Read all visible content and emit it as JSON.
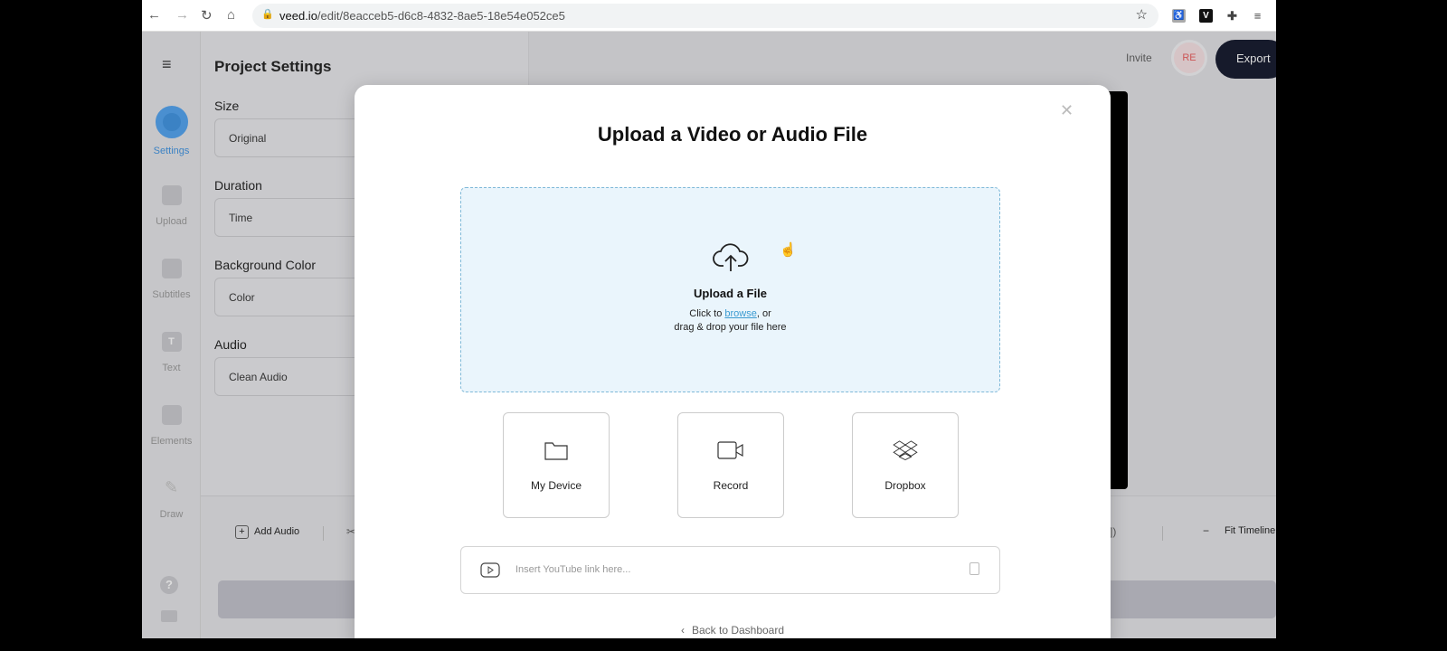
{
  "browser": {
    "url_domain": "veed.io",
    "url_path": "/edit/8eacceb5-d6c8-4832-8ae5-18e54e052ce5",
    "extensions": [
      "accessibility-icon",
      "veed-v-icon",
      "puzzle-icon",
      "media-icon"
    ],
    "ext_v": "V"
  },
  "rail": {
    "items": [
      {
        "label": "Settings",
        "active": true
      },
      {
        "label": "Upload"
      },
      {
        "label": "Subtitles"
      },
      {
        "label": "Text"
      },
      {
        "label": "Elements"
      },
      {
        "label": "Draw"
      }
    ]
  },
  "panel": {
    "title": "Project Settings",
    "sections": [
      {
        "label": "Size",
        "value": "Original"
      },
      {
        "label": "Duration",
        "value": "Time"
      },
      {
        "label": "Background Color",
        "value": "Color"
      },
      {
        "label": "Audio",
        "value": "Clean Audio"
      }
    ]
  },
  "header": {
    "invite": "Invite",
    "avatar": "RE",
    "export": "Export"
  },
  "toolbar": {
    "add_audio": "Add Audio",
    "fit_timeline": "Fit Timeline",
    "zoom_out": "−"
  },
  "modal": {
    "title": "Upload a Video or Audio File",
    "drop_title": "Upload a File",
    "drop_line1_prefix": "Click to ",
    "browse": "browse",
    "drop_line1_suffix": ", or",
    "drop_line2": "drag & drop your file here",
    "sources": [
      {
        "label": "My Device",
        "icon": "folder-icon"
      },
      {
        "label": "Record",
        "icon": "video-camera-icon"
      },
      {
        "label": "Dropbox",
        "icon": "dropbox-icon"
      }
    ],
    "youtube_placeholder": "Insert YouTube link here...",
    "back": "Back to Dashboard"
  },
  "colors": {
    "accent": "#3b82c4",
    "export_bg": "#161a2b",
    "link": "#3a9ad0"
  }
}
